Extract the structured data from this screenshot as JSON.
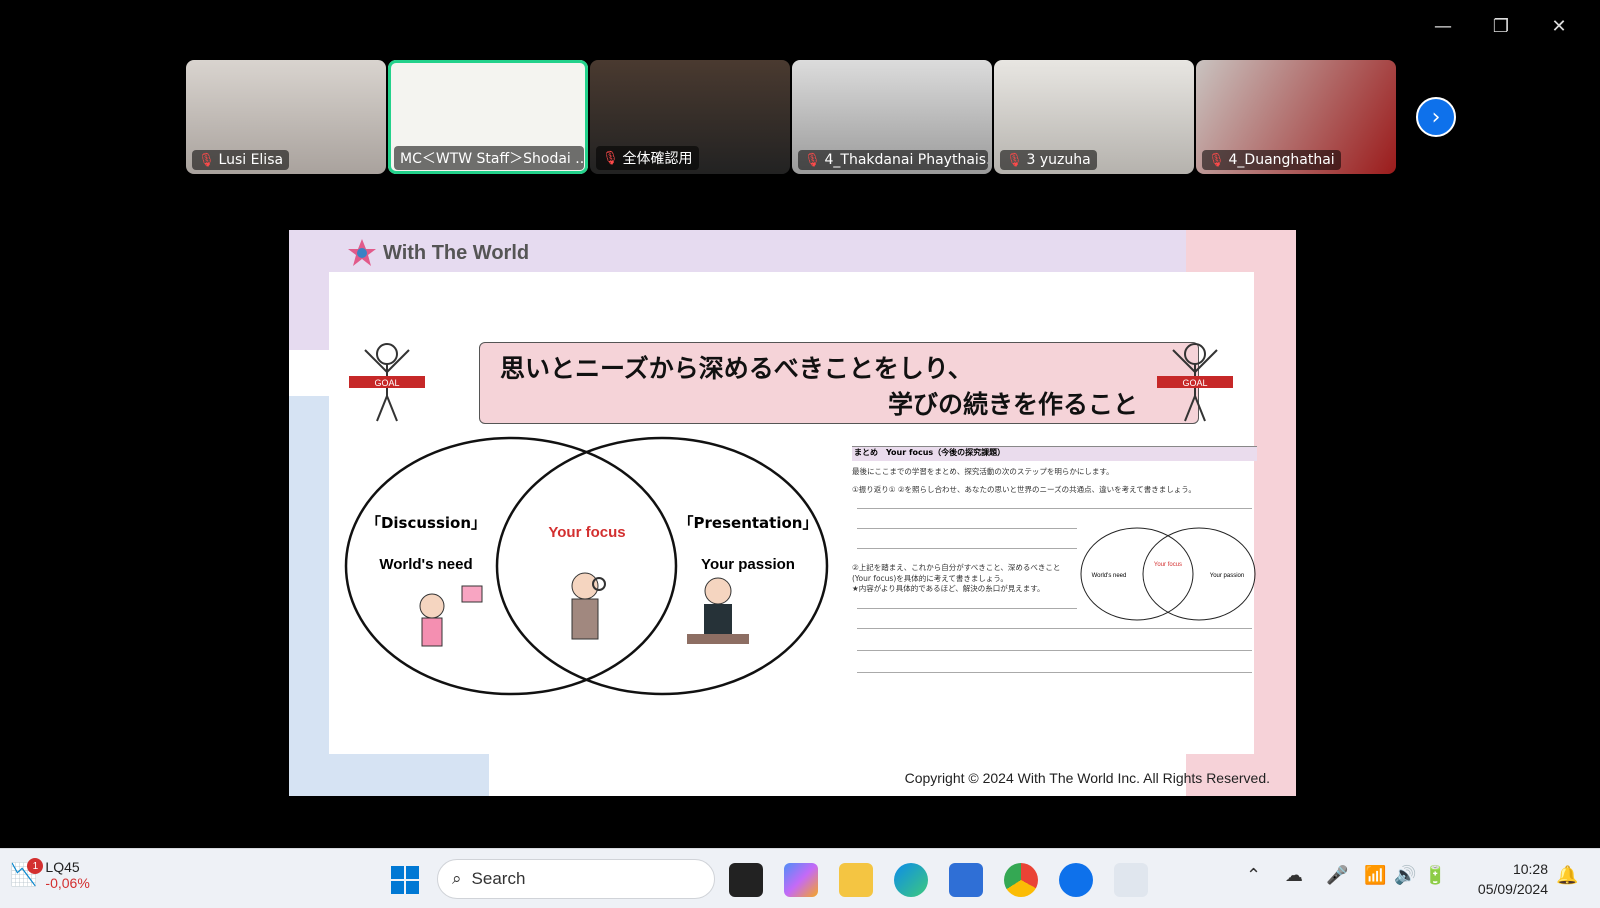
{
  "window_controls": {
    "minimize": "—",
    "restore": "❐",
    "close": "✕"
  },
  "participants": [
    {
      "name": "Lusi Elisa",
      "muted": true
    },
    {
      "name": "MC＜WTW Staff＞Shodai ...",
      "muted": false,
      "active": true
    },
    {
      "name": "全体確認用",
      "muted": true
    },
    {
      "name": "4_Thakdanai Phaythais...",
      "muted": true
    },
    {
      "name": "3 yuzuha",
      "muted": true
    },
    {
      "name": "4_Duanghathai",
      "muted": true
    }
  ],
  "slide": {
    "logo": "With The World",
    "title_line1": "思いとニーズから深めるべきことをしり、",
    "title_line2": "学びの続きを作ること",
    "goal_label": "GOAL",
    "venn": {
      "left_tag": "「Discussion」",
      "left_label": "World's need",
      "center_label": "Your focus",
      "right_tag": "「Presentation」",
      "right_label": "Your passion"
    },
    "worksheet": {
      "title": "まとめ　Your focus（今後の探究課題）",
      "line1": "最後にここまでの学習をまとめ、探究活動の次のステップを明らかにします。",
      "line2": "①振り返り① ②を照らし合わせ、あなたの思いと世界のニーズの共通点、違いを考えて書きましょう。",
      "line3": "②上記を踏まえ、これから自分がすべきこと、深めるべきこと(Your focus)を具体的に考えて書きましょう。",
      "line4": "★内容がより具体的であるほど、解決の糸口が見えます。",
      "mini_left": "World's need",
      "mini_center": "Your focus",
      "mini_right": "Your passion"
    },
    "copyright": "Copyright © 2024 With The World Inc. All Rights Reserved."
  },
  "taskbar": {
    "stock_ticker": "LQ45",
    "stock_change": "-0,06%",
    "stock_badge": "1",
    "search_label": "Search",
    "time": "10:28",
    "date": "05/09/2024"
  },
  "colors": {
    "accent": "#23d18b",
    "zoom_blue": "#0e71eb",
    "focus_red": "#d32f2f"
  }
}
